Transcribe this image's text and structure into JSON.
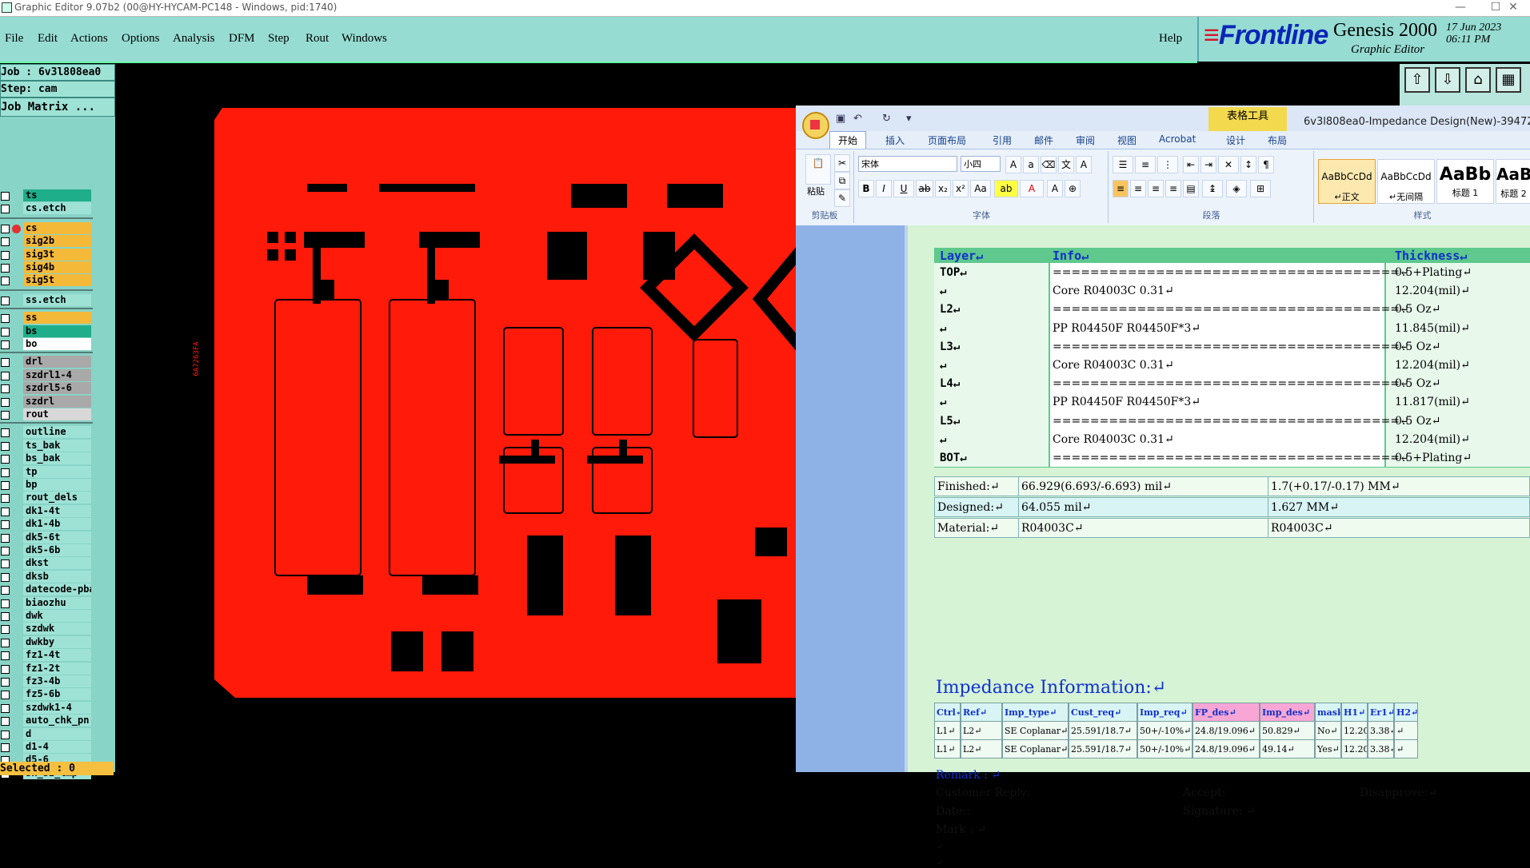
{
  "titlebar": {
    "title": "Graphic Editor 9.07b2 (00@HY-HYCAM-PC148 - Windows, pid:1740)",
    "minimize": "—",
    "maximize": "☐",
    "close": "✕"
  },
  "menu": [
    "File",
    "Edit",
    "Actions",
    "Options",
    "Analysis",
    "DFM",
    "Step",
    "Rout",
    "Windows"
  ],
  "help": "Help",
  "brand": {
    "logo": "Frontline",
    "product": "Genesis 2000",
    "subtitle": "Graphic Editor",
    "date": "17 Jun 2023",
    "time": "06:11 PM"
  },
  "job": {
    "job_line": "Job : 6v3l808ea0",
    "step_line": "Step: cam",
    "matrix_label": "Job Matrix ..."
  },
  "layers": [
    {
      "name": "ts",
      "color": "#1fae8a"
    },
    {
      "name": "cs.etch",
      "color": "#9ee2d6"
    },
    {
      "name": "cs",
      "color": "#f5b93a",
      "active": true
    },
    {
      "name": "sig2b",
      "color": "#f5b93a"
    },
    {
      "name": "sig3t",
      "color": "#f5b93a"
    },
    {
      "name": "sig4b",
      "color": "#f5b93a"
    },
    {
      "name": "sig5t",
      "color": "#f5b93a"
    },
    {
      "name": "ss.etch",
      "color": "#9ee2d6"
    },
    {
      "name": "ss",
      "color": "#f5b93a"
    },
    {
      "name": "bs",
      "color": "#1fae8a"
    },
    {
      "name": "bo",
      "color": "#ffffff"
    },
    {
      "name": "drl",
      "color": "#a9a9a9"
    },
    {
      "name": "szdrl1-4",
      "color": "#a9a9a9"
    },
    {
      "name": "szdrl5-6",
      "color": "#a9a9a9"
    },
    {
      "name": "szdrl",
      "color": "#a9a9a9"
    },
    {
      "name": "rout",
      "color": "#d8d8d8"
    },
    {
      "name": "outline",
      "color": "#9ee2d6"
    },
    {
      "name": "ts_bak",
      "color": "#9ee2d6"
    },
    {
      "name": "bs_bak",
      "color": "#9ee2d6"
    },
    {
      "name": "tp",
      "color": "#9ee2d6"
    },
    {
      "name": "bp",
      "color": "#9ee2d6"
    },
    {
      "name": "rout_dels",
      "color": "#9ee2d6"
    },
    {
      "name": "dk1-4t",
      "color": "#9ee2d6"
    },
    {
      "name": "dk1-4b",
      "color": "#9ee2d6"
    },
    {
      "name": "dk5-6t",
      "color": "#9ee2d6"
    },
    {
      "name": "dk5-6b",
      "color": "#9ee2d6"
    },
    {
      "name": "dkst",
      "color": "#9ee2d6"
    },
    {
      "name": "dksb",
      "color": "#9ee2d6"
    },
    {
      "name": "datecode-pba",
      "color": "#9ee2d6"
    },
    {
      "name": "biaozhu",
      "color": "#9ee2d6"
    },
    {
      "name": "dwk",
      "color": "#9ee2d6"
    },
    {
      "name": "szdwk",
      "color": "#9ee2d6"
    },
    {
      "name": "dwkby",
      "color": "#9ee2d6"
    },
    {
      "name": "fz1-4t",
      "color": "#9ee2d6"
    },
    {
      "name": "fz1-2t",
      "color": "#9ee2d6"
    },
    {
      "name": "fz3-4b",
      "color": "#9ee2d6"
    },
    {
      "name": "fz5-6b",
      "color": "#9ee2d6"
    },
    {
      "name": "szdwk1-4",
      "color": "#9ee2d6"
    },
    {
      "name": "auto_chk_pn",
      "color": "#9ee2d6"
    },
    {
      "name": "d",
      "color": "#9ee2d6"
    },
    {
      "name": "d1-4",
      "color": "#9ee2d6"
    },
    {
      "name": "d5-6",
      "color": "#9ee2d6"
    },
    {
      "name": "sk_sz_tmp",
      "color": "#9ee2d6"
    }
  ],
  "selected": "Selected : 0",
  "pcb": {
    "label": "6A7263FA"
  },
  "word": {
    "context_tab": "表格工具",
    "doc_title": "6v3l808ea0-Impedance Design(New)-39472 [兼容",
    "tabs": [
      "开始",
      "插入",
      "页面布局",
      "引用",
      "邮件",
      "审阅",
      "视图",
      "Acrobat",
      "设计",
      "布局"
    ],
    "groups": {
      "clipboard": "剪贴板",
      "font": "字体",
      "paragraph": "段落",
      "styles": "样式"
    },
    "paste_label": "粘贴",
    "font_name": "宋体",
    "font_size": "小四",
    "styles": [
      {
        "preview": "AaBbCcDd",
        "name": "↵正文"
      },
      {
        "preview": "AaBbCcDd",
        "name": "↵无间隔"
      },
      {
        "preview": "AaBb",
        "name": "标题 1"
      },
      {
        "preview": "AaBb",
        "name": "标题 2"
      }
    ]
  },
  "stackup": {
    "headers": [
      "Layer↵",
      "Info↵",
      "Thickness↵"
    ],
    "rows": [
      {
        "layer": "TOP↵",
        "info": "=====================================↵",
        "thickness": "0.5+Plating↵"
      },
      {
        "layer": "↵",
        "info": "Core      R04003C     0.31↵",
        "thickness": "12.204(mil)↵"
      },
      {
        "layer": "L2↵",
        "info": "=====================================↵",
        "thickness": "0.5 Oz↵"
      },
      {
        "layer": "↵",
        "info": "PP      R04450F     R04450F*3↵",
        "thickness": "11.845(mil)↵"
      },
      {
        "layer": "L3↵",
        "info": "=====================================↵",
        "thickness": "0.5 Oz↵"
      },
      {
        "layer": "↵",
        "info": "Core      R04003C     0.31↵",
        "thickness": "12.204(mil)↵"
      },
      {
        "layer": "L4↵",
        "info": "=====================================↵",
        "thickness": "0.5 Oz↵"
      },
      {
        "layer": "↵",
        "info": "PP      R04450F     R04450F*3↵",
        "thickness": "11.817(mil)↵"
      },
      {
        "layer": "L5↵",
        "info": "=====================================↵",
        "thickness": "0.5 Oz↵"
      },
      {
        "layer": "↵",
        "info": "Core      R04003C     0.31↵",
        "thickness": "12.204(mil)↵"
      },
      {
        "layer": "BOT↵",
        "info": "=====================================↵",
        "thickness": "0.5+Plating↵"
      }
    ]
  },
  "spec": [
    {
      "label": "Finished:↵",
      "v1": "66.929(6.693/-6.693) mil↵",
      "v2": "1.7(+0.17/-0.17) MM↵"
    },
    {
      "label": "Designed:↵",
      "v1": "64.055 mil↵",
      "v2": "1.627 MM↵"
    },
    {
      "label": "Material:↵",
      "v1": "R04003C↵",
      "v2": "R04003C↵"
    }
  ],
  "impedance": {
    "title": "Impedance Information:↵",
    "headers": [
      "Ctrl↵",
      "Ref↵",
      "Imp_type↵",
      "Cust_req↵",
      "Imp_req↵",
      "FP_des↵",
      "Imp_des↵",
      "mask↵",
      "H1↵",
      "Er1↵",
      "H2↵"
    ],
    "rows": [
      [
        "L1↵",
        "L2↵",
        "SE Coplanar↵",
        "25.591/18.7↵",
        "50+/-10%↵",
        "24.8/19.096↵",
        "50.829↵",
        "No↵",
        "12.204",
        "3.38↵",
        "↵"
      ],
      [
        "L1↵",
        "L2↵",
        "SE Coplanar↵",
        "25.591/18.7↵",
        "50+/-10%↵",
        "24.8/19.096↵",
        "49.14↵",
        "Yes↵",
        "12.204",
        "3.38↵",
        "↵"
      ]
    ]
  },
  "footer": {
    "remark": "Remark : ↵",
    "customer_reply": "Customer Reply:",
    "accept": "Accept:",
    "disapprove": "Disapprove:↵",
    "date": "Date::",
    "signature": "Signature: ↵",
    "mark": "Mark : ↵",
    "blank1": "↵",
    "blank2": "↵"
  }
}
